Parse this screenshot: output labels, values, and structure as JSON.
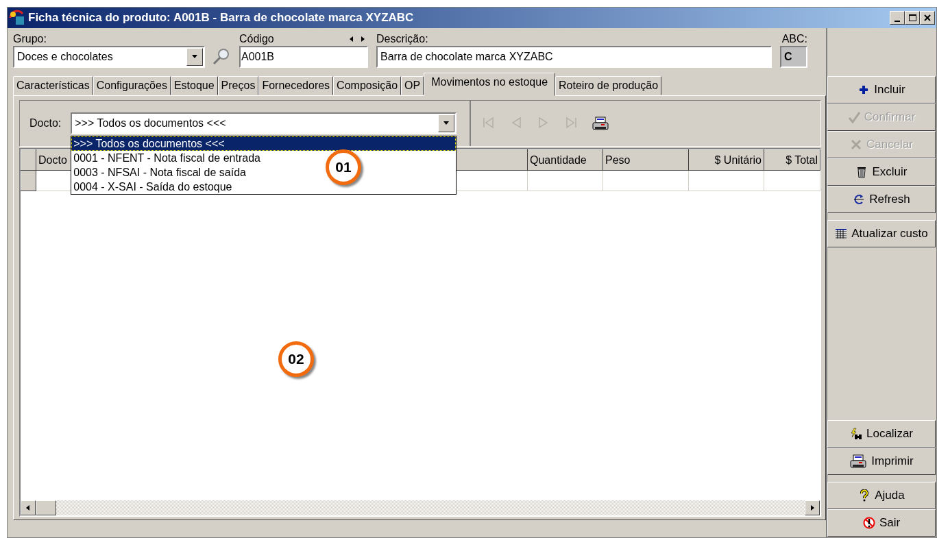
{
  "window": {
    "title": "Ficha técnica do produto: A001B - Barra de chocolate marca XYZABC"
  },
  "fields": {
    "grupo": {
      "label": "Grupo:",
      "value": "Doces e chocolates"
    },
    "codigo": {
      "label": "Código",
      "value": "A001B"
    },
    "descricao": {
      "label": "Descrição:",
      "value": "Barra de chocolate marca XYZABC"
    },
    "abc": {
      "label": "ABC:",
      "value": "C"
    }
  },
  "tabs": [
    {
      "label": "Características",
      "selected": false
    },
    {
      "label": "Configurações",
      "selected": false
    },
    {
      "label": "Estoque",
      "selected": false
    },
    {
      "label": "Preços",
      "selected": false
    },
    {
      "label": "Fornecedores",
      "selected": false
    },
    {
      "label": "Composição",
      "selected": false
    },
    {
      "label": "OP",
      "selected": false
    },
    {
      "label": "Movimentos no estoque",
      "selected": true
    },
    {
      "label": "Roteiro de produção",
      "selected": false
    }
  ],
  "docto_filter": {
    "label": "Docto:",
    "value": ">>> Todos os documentos <<<",
    "options": [
      {
        "text": ">>> Todos os documentos <<<",
        "selected": true
      },
      {
        "text": "0001 - NFENT - Nota fiscal de entrada",
        "selected": false
      },
      {
        "text": "0003 - NFSAI - Nota fiscal de saída",
        "selected": false
      },
      {
        "text": "0004 - X-SAI - Saída do estoque",
        "selected": false
      }
    ]
  },
  "nav_buttons": [
    {
      "kind": "first",
      "disabled": true
    },
    {
      "kind": "prev",
      "disabled": true
    },
    {
      "kind": "next",
      "disabled": true
    },
    {
      "kind": "last",
      "disabled": true
    },
    {
      "kind": "print",
      "disabled": false
    }
  ],
  "grid": {
    "columns": [
      {
        "kind": "text",
        "label": "Docto"
      },
      {
        "kind": "blank"
      },
      {
        "kind": "text",
        "label": "Quantidade"
      },
      {
        "kind": "text",
        "label": "Peso"
      },
      {
        "kind": "text",
        "label": "$ Unitário"
      },
      {
        "kind": "text",
        "label": "$ Total"
      }
    ]
  },
  "action_groups": [
    {
      "buttons": [
        {
          "label": "Incluir",
          "disabled": false
        },
        {
          "label": "Confirmar",
          "disabled": true
        },
        {
          "label": "Cancelar",
          "disabled": true
        },
        {
          "label": "Excluir",
          "disabled": false
        },
        {
          "label": "Refresh",
          "disabled": false
        }
      ]
    },
    {
      "buttons": [
        {
          "label": "Atualizar custo",
          "disabled": false
        }
      ]
    },
    {
      "buttons": [
        {
          "label": "Localizar",
          "disabled": false
        },
        {
          "label": "Imprimir",
          "disabled": false
        }
      ]
    },
    {
      "buttons": [
        {
          "label": "Ajuda",
          "disabled": false
        },
        {
          "label": "Sair",
          "disabled": false
        }
      ]
    }
  ],
  "callouts": [
    {
      "label": "01"
    },
    {
      "label": "02"
    }
  ]
}
